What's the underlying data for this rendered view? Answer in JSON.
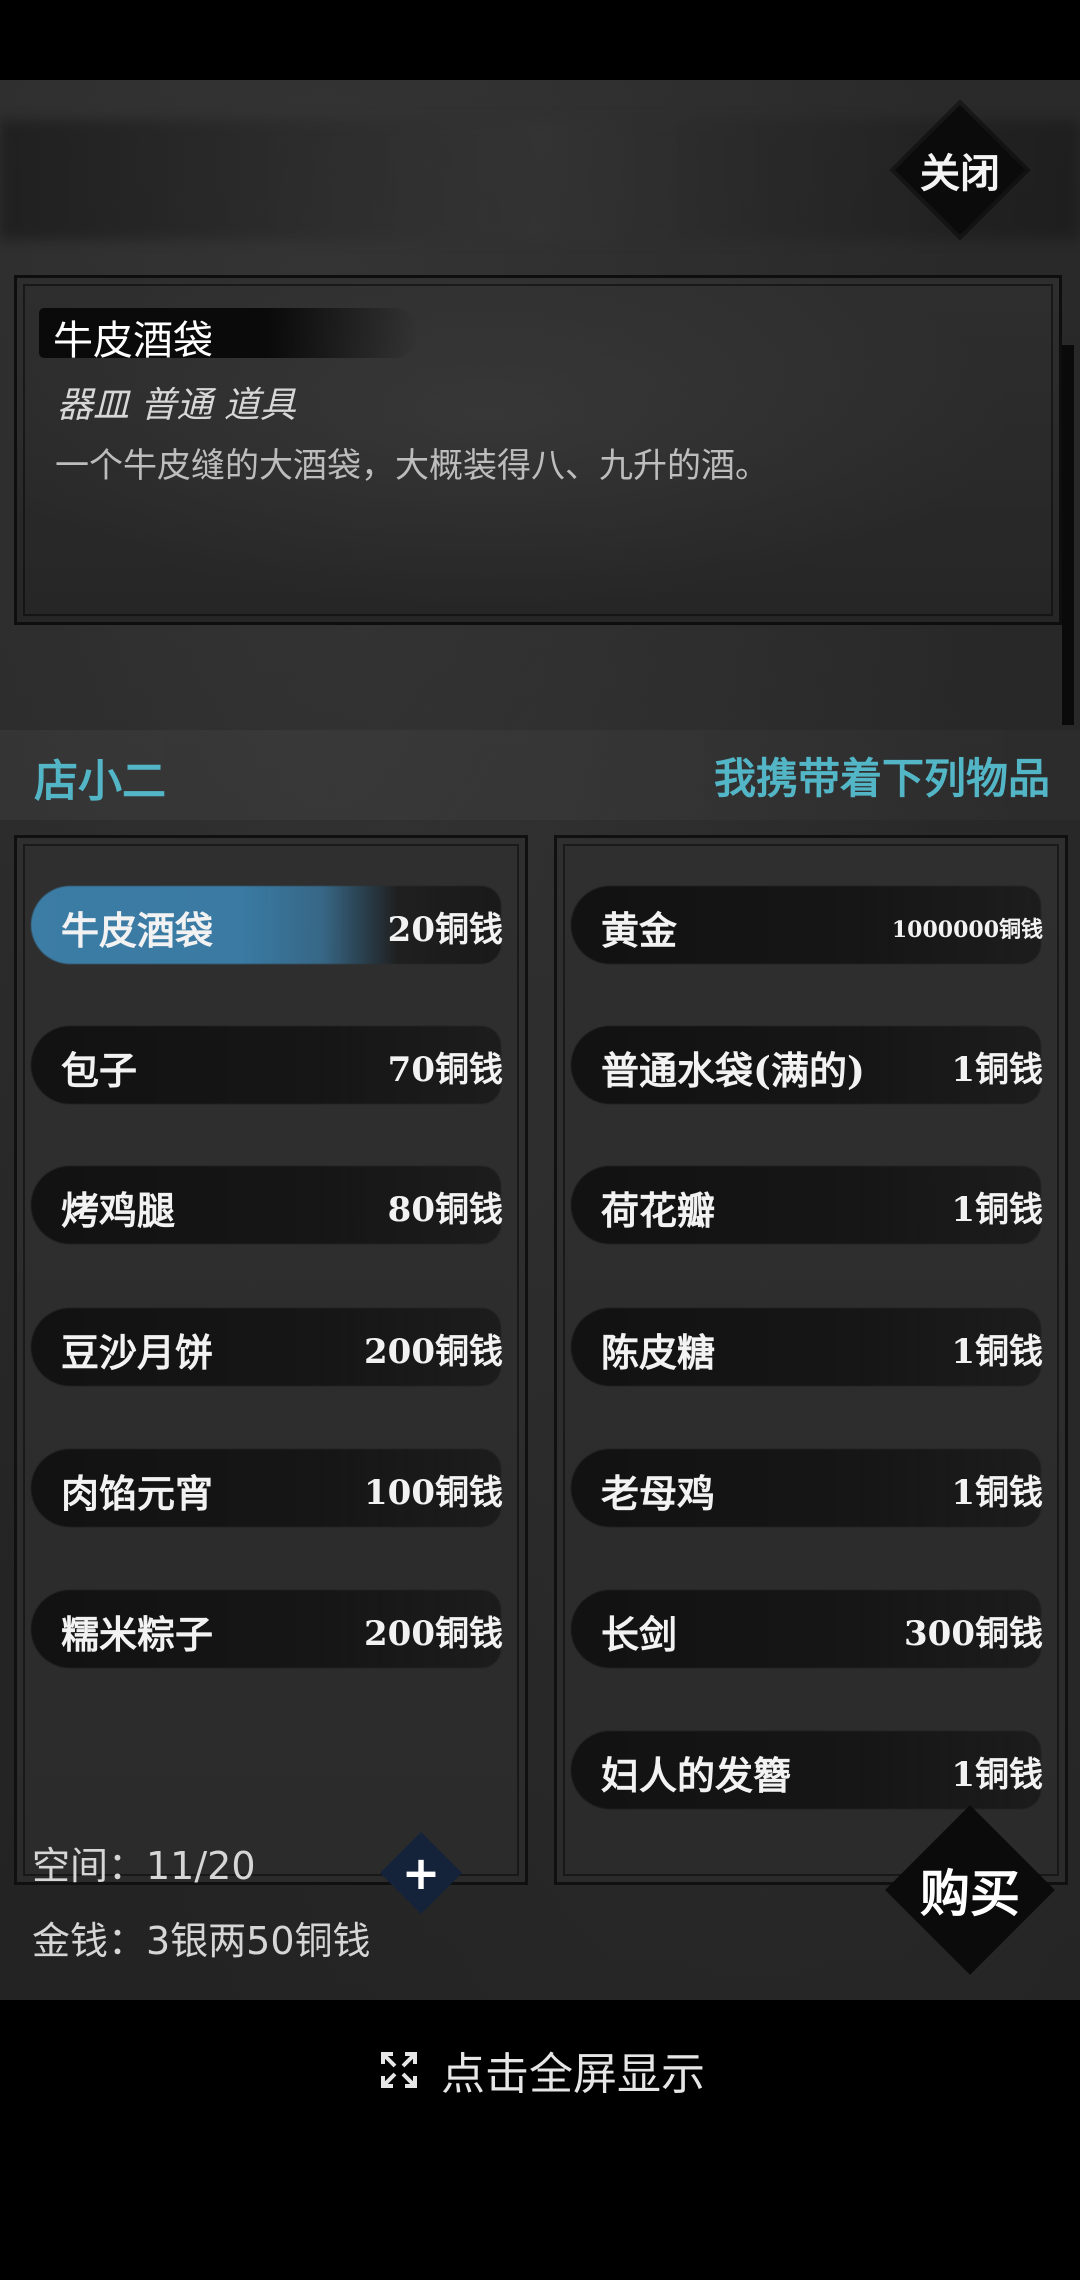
{
  "close_button": {
    "label": "关闭"
  },
  "description": {
    "name": "牛皮酒袋",
    "type": "器皿 普通 道具",
    "text": "一个牛皮缝的大酒袋，大概装得八、九升的酒。"
  },
  "left_heading": "店小二",
  "right_heading": "我携带着下列物品",
  "left_items": [
    {
      "name": "牛皮酒袋",
      "price": "20铜钱"
    },
    {
      "name": "包子",
      "price": "70铜钱"
    },
    {
      "name": "烤鸡腿",
      "price": "80铜钱"
    },
    {
      "name": "豆沙月饼",
      "price": "200铜钱"
    },
    {
      "name": "肉馅元宵",
      "price": "100铜钱"
    },
    {
      "name": "糯米粽子",
      "price": "200铜钱"
    }
  ],
  "right_items": [
    {
      "name": "黄金",
      "price": "1000000铜钱"
    },
    {
      "name": "普通水袋(满的)",
      "price": "1铜钱"
    },
    {
      "name": "荷花瓣",
      "price": "1铜钱"
    },
    {
      "name": "陈皮糖",
      "price": "1铜钱"
    },
    {
      "name": "老母鸡",
      "price": "1铜钱"
    },
    {
      "name": "长剑",
      "price": "300铜钱"
    },
    {
      "name": "妇人的发簪",
      "price": "1铜钱"
    }
  ],
  "status": {
    "space": "空间：11/20",
    "money": "金钱：3银两50铜钱"
  },
  "add_button": {
    "icon": "plus-icon"
  },
  "buy_button": {
    "label": "购买"
  },
  "fullscreen": {
    "label": "点击全屏显示",
    "icon": "expand-icon"
  },
  "colors": {
    "accent": "#53b6c7",
    "selected": "#3c7da6"
  }
}
